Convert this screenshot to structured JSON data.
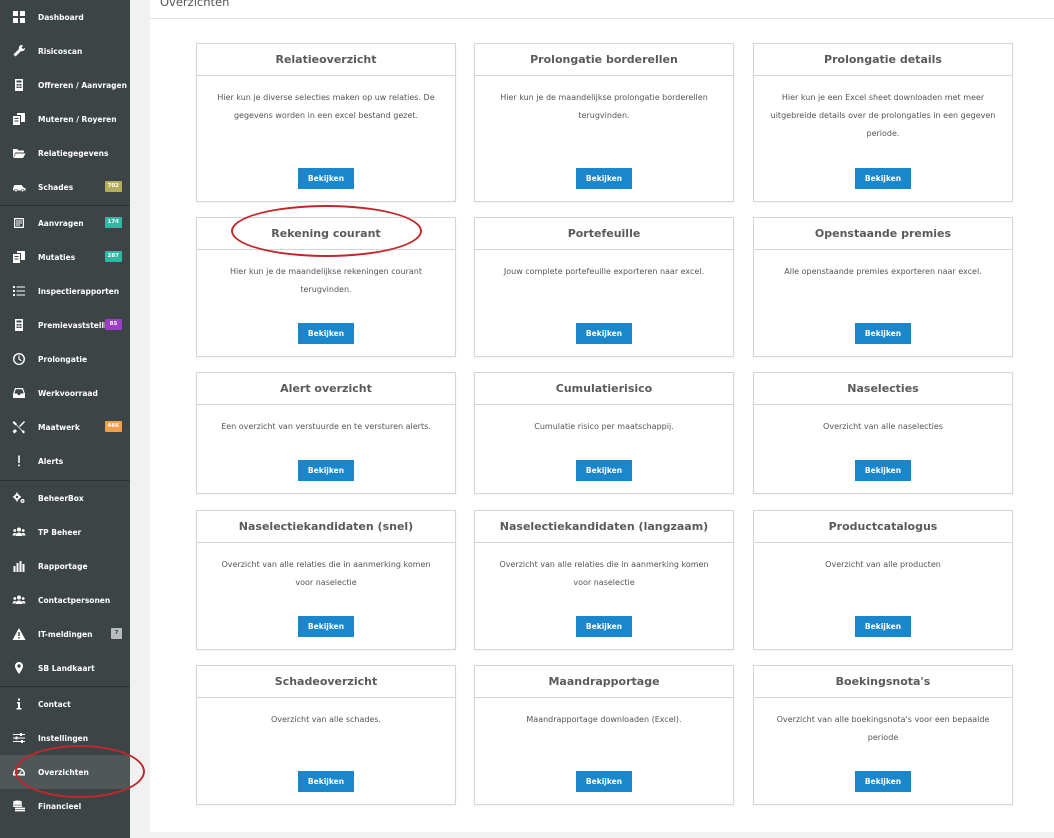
{
  "sidebar": {
    "items": [
      {
        "label": "Dashboard",
        "icon": "dashboard-icon"
      },
      {
        "label": "Risicoscan",
        "icon": "wrench-icon"
      },
      {
        "label": "Offreren / Aanvragen",
        "icon": "calculator-icon"
      },
      {
        "label": "Muteren / Royeren",
        "icon": "documents-icon"
      },
      {
        "label": "Relatiegegevens",
        "icon": "folder-icon"
      },
      {
        "label": "Schades",
        "icon": "car-icon",
        "badge": "702",
        "badge_color": "#b5ad5a"
      },
      {
        "label": "Aanvragen",
        "icon": "checklist-icon",
        "badge": "174",
        "badge_color": "#2fb8a4"
      },
      {
        "label": "Mutaties",
        "icon": "documents-icon",
        "badge": "287",
        "badge_color": "#2fb8a4"
      },
      {
        "label": "Inspectierapporten",
        "icon": "list-icon"
      },
      {
        "label": "Premievaststelling",
        "icon": "calculator-icon",
        "badge": "85",
        "badge_color": "#9b3fc4"
      },
      {
        "label": "Prolongatie",
        "icon": "clock-icon"
      },
      {
        "label": "Werkvoorraad",
        "icon": "inbox-icon"
      },
      {
        "label": "Maatwerk",
        "icon": "tools-icon",
        "badge": "466",
        "badge_color": "#f0a04b"
      },
      {
        "label": "Alerts",
        "icon": "exclamation-icon"
      },
      {
        "label": "BeheerBox",
        "icon": "gears-icon"
      },
      {
        "label": "TP Beheer",
        "icon": "users-icon"
      },
      {
        "label": "Rapportage",
        "icon": "bar-chart-icon"
      },
      {
        "label": "Contactpersonen",
        "icon": "users-icon"
      },
      {
        "label": "IT-meldingen",
        "icon": "warning-icon",
        "badge": "7",
        "badge_color": "#b8bcbd"
      },
      {
        "label": "SB Landkaart",
        "icon": "map-pin-icon"
      },
      {
        "label": "Contact",
        "icon": "info-icon"
      },
      {
        "label": "Instellingen",
        "icon": "sliders-icon"
      },
      {
        "label": "Overzichten",
        "icon": "gauge-icon",
        "active": true
      },
      {
        "label": "Financieel",
        "icon": "coins-icon"
      }
    ]
  },
  "page": {
    "title": "Overzichten"
  },
  "cards": [
    {
      "title": "Relatieoverzicht",
      "desc": "Hier kun je diverse selecties maken op uw relaties. De gegevens worden in een excel bestand gezet.",
      "button": "Bekijken"
    },
    {
      "title": "Prolongatie borderellen",
      "desc": "Hier kun je de maandelijkse prolongatie borderellen terugvinden.",
      "button": "Bekijken"
    },
    {
      "title": "Prolongatie details",
      "desc": "Hier kun je een Excel sheet downloaden met meer uitgebreide details over de prolongaties in een gegeven periode.",
      "button": "Bekijken"
    },
    {
      "title": "Rekening courant",
      "desc": "Hier kun je de maandelijkse rekeningen courant terugvinden.",
      "button": "Bekijken"
    },
    {
      "title": "Portefeuille",
      "desc": "Jouw complete portefeuille exporteren naar excel.",
      "button": "Bekijken"
    },
    {
      "title": "Openstaande premies",
      "desc": "Alle openstaande premies exporteren naar excel.",
      "button": "Bekijken"
    },
    {
      "title": "Alert overzicht",
      "desc": "Een overzicht van verstuurde en te versturen alerts.",
      "button": "Bekijken"
    },
    {
      "title": "Cumulatierisico",
      "desc": "Cumulatie risico per maatschappij.",
      "button": "Bekijken"
    },
    {
      "title": "Naselecties",
      "desc": "Overzicht van alle naselecties",
      "button": "Bekijken"
    },
    {
      "title": "Naselectiekandidaten (snel)",
      "desc": "Overzicht van alle relaties die in aanmerking komen voor naselectie",
      "button": "Bekijken"
    },
    {
      "title": "Naselectiekandidaten (langzaam)",
      "desc": "Overzicht van alle relaties die in aanmerking komen voor naselectie",
      "button": "Bekijken"
    },
    {
      "title": "Productcatalogus",
      "desc": "Overzicht van alle producten",
      "button": "Bekijken"
    },
    {
      "title": "Schadeoverzicht",
      "desc": "Overzicht van alle schades.",
      "button": "Bekijken"
    },
    {
      "title": "Maandrapportage",
      "desc": "Maandrapportage downloaden (Excel).",
      "button": "Bekijken"
    },
    {
      "title": "Boekingsnota's",
      "desc": "Overzicht van alle boekingsnota's voor een bepaalde periode",
      "button": "Bekijken"
    }
  ],
  "colors": {
    "sidebar_bg": "#3d4446",
    "button_bg": "#1a86cc",
    "annotation": "#c0282c"
  }
}
